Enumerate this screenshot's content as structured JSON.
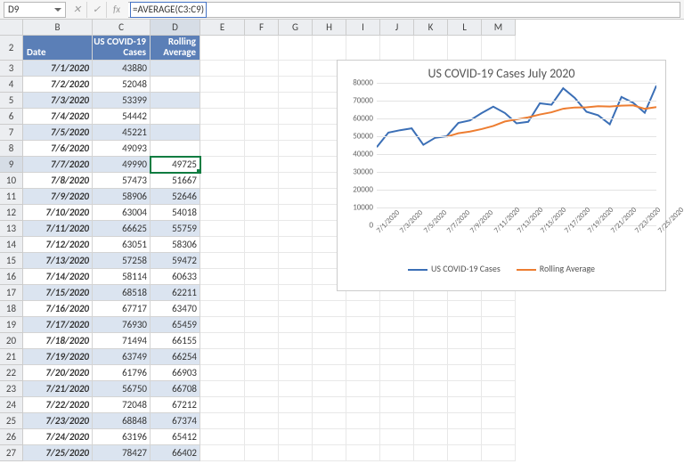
{
  "namebox": "D9",
  "formula": "=AVERAGE(C3:C9)",
  "columns": [
    "B",
    "C",
    "D",
    "E",
    "F",
    "G",
    "H",
    "I",
    "J",
    "K",
    "L",
    "M"
  ],
  "rows_start": 2,
  "rows_end": 27,
  "headers": {
    "date": "Date",
    "cases": "US COVID-19\nCases",
    "roll": "Rolling\nAverage"
  },
  "table": [
    {
      "date": "7/1/2020",
      "cases": 43880,
      "roll": ""
    },
    {
      "date": "7/2/2020",
      "cases": 52048,
      "roll": ""
    },
    {
      "date": "7/3/2020",
      "cases": 53399,
      "roll": ""
    },
    {
      "date": "7/4/2020",
      "cases": 54442,
      "roll": ""
    },
    {
      "date": "7/5/2020",
      "cases": 45221,
      "roll": ""
    },
    {
      "date": "7/6/2020",
      "cases": 49093,
      "roll": ""
    },
    {
      "date": "7/7/2020",
      "cases": 49990,
      "roll": 49725
    },
    {
      "date": "7/8/2020",
      "cases": 57473,
      "roll": 51667
    },
    {
      "date": "7/9/2020",
      "cases": 58906,
      "roll": 52646
    },
    {
      "date": "7/10/2020",
      "cases": 63004,
      "roll": 54018
    },
    {
      "date": "7/11/2020",
      "cases": 66625,
      "roll": 55759
    },
    {
      "date": "7/12/2020",
      "cases": 63051,
      "roll": 58306
    },
    {
      "date": "7/13/2020",
      "cases": 57258,
      "roll": 59472
    },
    {
      "date": "7/14/2020",
      "cases": 58114,
      "roll": 60633
    },
    {
      "date": "7/15/2020",
      "cases": 68518,
      "roll": 62211
    },
    {
      "date": "7/16/2020",
      "cases": 67717,
      "roll": 63470
    },
    {
      "date": "7/17/2020",
      "cases": 76930,
      "roll": 65459
    },
    {
      "date": "7/18/2020",
      "cases": 71494,
      "roll": 66155
    },
    {
      "date": "7/19/2020",
      "cases": 63749,
      "roll": 66254
    },
    {
      "date": "7/20/2020",
      "cases": 61796,
      "roll": 66903
    },
    {
      "date": "7/21/2020",
      "cases": 56750,
      "roll": 66708
    },
    {
      "date": "7/22/2020",
      "cases": 72048,
      "roll": 67212
    },
    {
      "date": "7/23/2020",
      "cases": 68848,
      "roll": 67374
    },
    {
      "date": "7/24/2020",
      "cases": 63196,
      "roll": 65412
    },
    {
      "date": "7/25/2020",
      "cases": 78427,
      "roll": 66402
    }
  ],
  "chart_data": {
    "type": "line",
    "title": "US COVID-19 Cases July 2020",
    "xlabel": "",
    "ylabel": "",
    "ylim": [
      0,
      80000
    ],
    "ytick_step": 10000,
    "categories": [
      "7/1/2020",
      "7/2/2020",
      "7/3/2020",
      "7/4/2020",
      "7/5/2020",
      "7/6/2020",
      "7/7/2020",
      "7/8/2020",
      "7/9/2020",
      "7/10/2020",
      "7/11/2020",
      "7/12/2020",
      "7/13/2020",
      "7/14/2020",
      "7/15/2020",
      "7/16/2020",
      "7/17/2020",
      "7/18/2020",
      "7/19/2020",
      "7/20/2020",
      "7/21/2020",
      "7/22/2020",
      "7/23/2020",
      "7/24/2020",
      "7/25/2020"
    ],
    "x_visible": [
      "7/1/2020",
      "7/3/2020",
      "7/5/2020",
      "7/7/2020",
      "7/9/2020",
      "7/11/2020",
      "7/13/2020",
      "7/15/2020",
      "7/17/2020",
      "7/19/2020",
      "7/21/2020",
      "7/23/2020",
      "7/25/2020"
    ],
    "series": [
      {
        "name": "US COVID-19 Cases",
        "color": "#3b6fb6",
        "values": [
          43880,
          52048,
          53399,
          54442,
          45221,
          49093,
          49990,
          57473,
          58906,
          63004,
          66625,
          63051,
          57258,
          58114,
          68518,
          67717,
          76930,
          71494,
          63749,
          61796,
          56750,
          72048,
          68848,
          63196,
          78427
        ]
      },
      {
        "name": "Rolling Average",
        "color": "#ed7d31",
        "values": [
          null,
          null,
          null,
          null,
          null,
          null,
          49725,
          51667,
          52646,
          54018,
          55759,
          58306,
          59472,
          60633,
          62211,
          63470,
          65459,
          66155,
          66254,
          66903,
          66708,
          67212,
          67374,
          65412,
          66402
        ]
      }
    ]
  },
  "colors": {
    "header_bg": "#5b7fb7",
    "band": "#dbe4f0",
    "sel": "#107c41"
  }
}
